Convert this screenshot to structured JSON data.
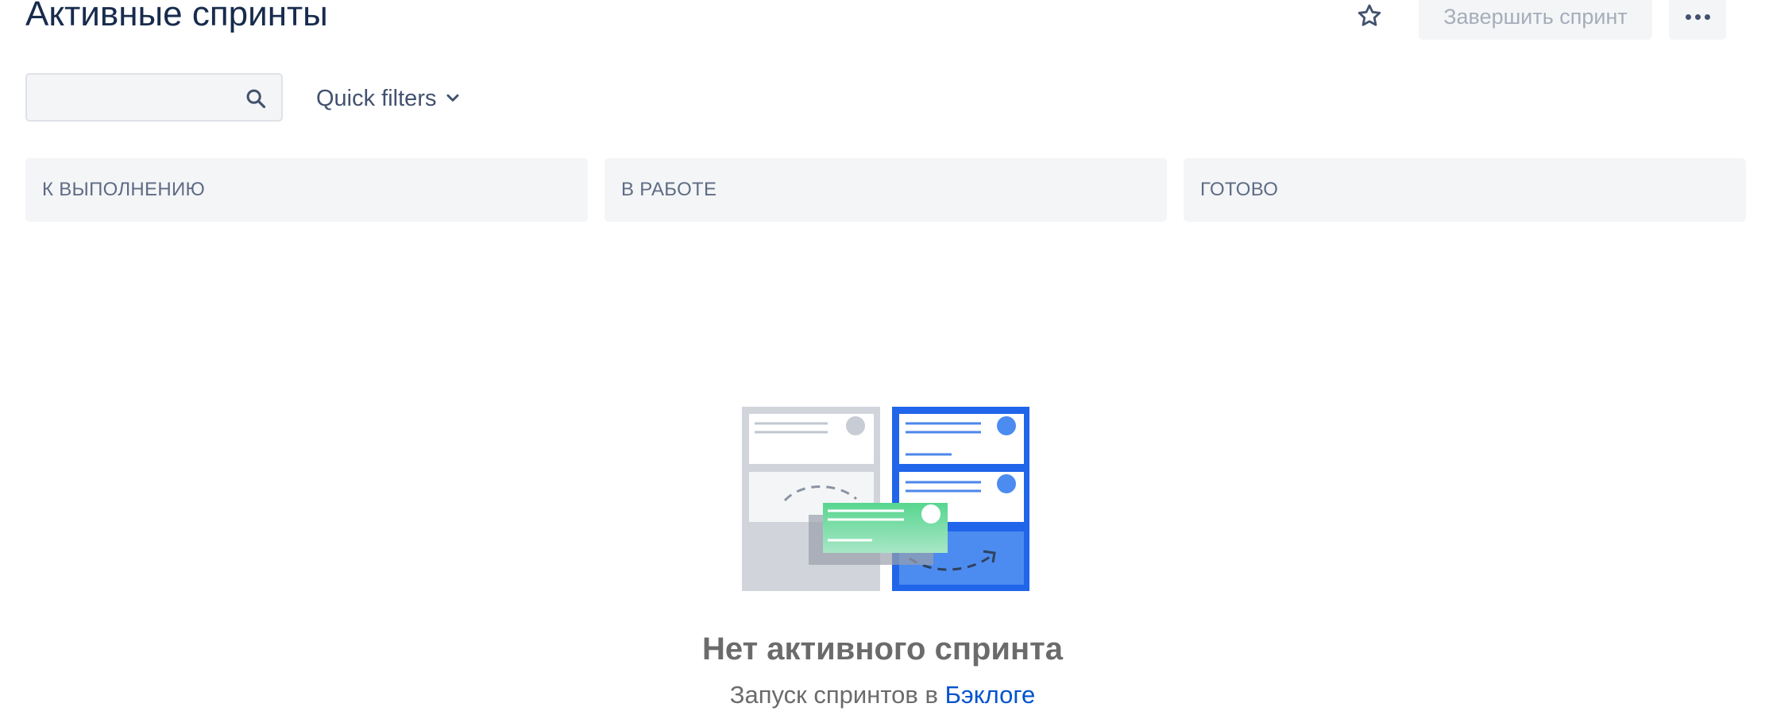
{
  "header": {
    "title": "Активные спринты",
    "star_icon": "star-icon",
    "complete_sprint_label": "Завершить спринт",
    "more_icon": "more-horizontal-icon"
  },
  "toolbar": {
    "search": {
      "value": "",
      "placeholder": "",
      "icon": "search-icon"
    },
    "quick_filters_label": "Quick filters",
    "quick_filters_icon": "chevron-down-icon"
  },
  "columns": [
    {
      "label": "К ВЫПОЛНЕНИЮ"
    },
    {
      "label": "В РАБОТЕ"
    },
    {
      "label": "ГОТОВО"
    }
  ],
  "empty_state": {
    "illustration": "board-illustration",
    "title": "Нет активного спринта",
    "subtitle_prefix": "Запуск спринтов в ",
    "backlog_link": "Бэклоге"
  },
  "colors": {
    "text_primary": "#172b4d",
    "text_secondary": "#42526e",
    "disabled_text": "#a5adba",
    "surface": "#f4f5f7",
    "link": "#0052cc",
    "illustration_blue": "#2065ea",
    "illustration_green": "#7fdca4"
  }
}
